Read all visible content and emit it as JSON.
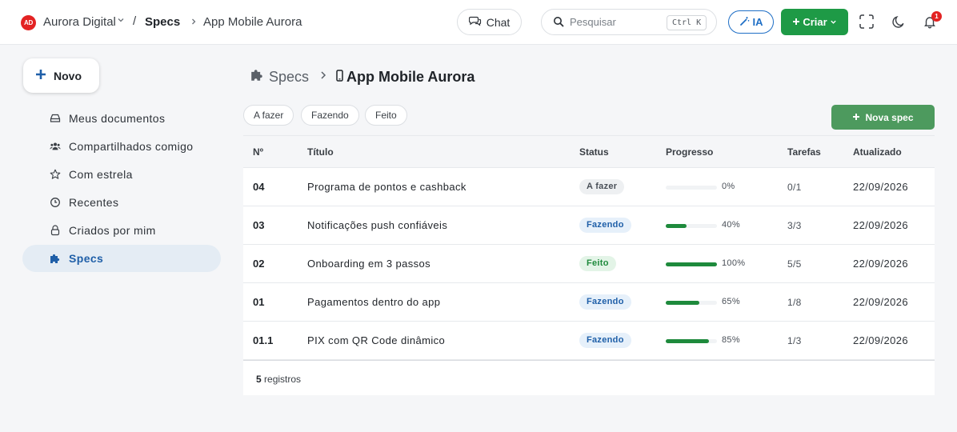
{
  "header": {
    "org_logo": "AD",
    "org_name": "Aurora Digital",
    "crumb_separator": "/",
    "crumb_specs": "Specs",
    "crumb_app": "App Mobile Aurora",
    "chat_label": "Chat",
    "search_placeholder": "Pesquisar",
    "search_shortcut": "Ctrl K",
    "ia_label": "IA",
    "criar_label": "Criar",
    "notification_count": "1"
  },
  "sidebar": {
    "novo_label": "Novo",
    "items": [
      {
        "label": "Meus documentos",
        "icon": "drive-icon"
      },
      {
        "label": "Compartilhados comigo",
        "icon": "users-icon"
      },
      {
        "label": "Com estrela",
        "icon": "star-icon"
      },
      {
        "label": "Recentes",
        "icon": "clock-icon"
      },
      {
        "label": "Criados por mim",
        "icon": "lock-icon"
      },
      {
        "label": "Specs",
        "icon": "puzzle-icon",
        "active": true
      }
    ]
  },
  "main": {
    "title_specs": "Specs",
    "title_app": "App Mobile Aurora",
    "filters": [
      "A fazer",
      "Fazendo",
      "Feito"
    ],
    "nova_spec_label": "Nova spec",
    "columns": [
      "Nº",
      "Título",
      "Status",
      "Progresso",
      "Tarefas",
      "Atualizado"
    ],
    "rows": [
      {
        "num": "04",
        "title": "Programa de pontos e cashback",
        "status": "A fazer",
        "status_kind": "todo",
        "progress": 0,
        "progress_label": "0%",
        "tasks": "0/1",
        "updated": "22/09/2026"
      },
      {
        "num": "03",
        "title": "Notificações push confiáveis",
        "status": "Fazendo",
        "status_kind": "doing",
        "progress": 40,
        "progress_label": "40%",
        "tasks": "3/3",
        "updated": "22/09/2026"
      },
      {
        "num": "02",
        "title": "Onboarding em 3 passos",
        "status": "Feito",
        "status_kind": "done",
        "progress": 100,
        "progress_label": "100%",
        "tasks": "5/5",
        "updated": "22/09/2026"
      },
      {
        "num": "01",
        "title": "Pagamentos dentro do app",
        "status": "Fazendo",
        "status_kind": "doing",
        "progress": 65,
        "progress_label": "65%",
        "tasks": "1/8",
        "updated": "22/09/2026"
      },
      {
        "num": "01.1",
        "title": "PIX com QR Code dinâmico",
        "status": "Fazendo",
        "status_kind": "doing",
        "progress": 85,
        "progress_label": "85%",
        "tasks": "1/3",
        "updated": "22/09/2026"
      }
    ],
    "footer_count": "5",
    "footer_label": "registros"
  },
  "colors": {
    "accent_green": "#1e9a46",
    "accent_blue": "#1f6fc6",
    "danger_red": "#e32323"
  }
}
